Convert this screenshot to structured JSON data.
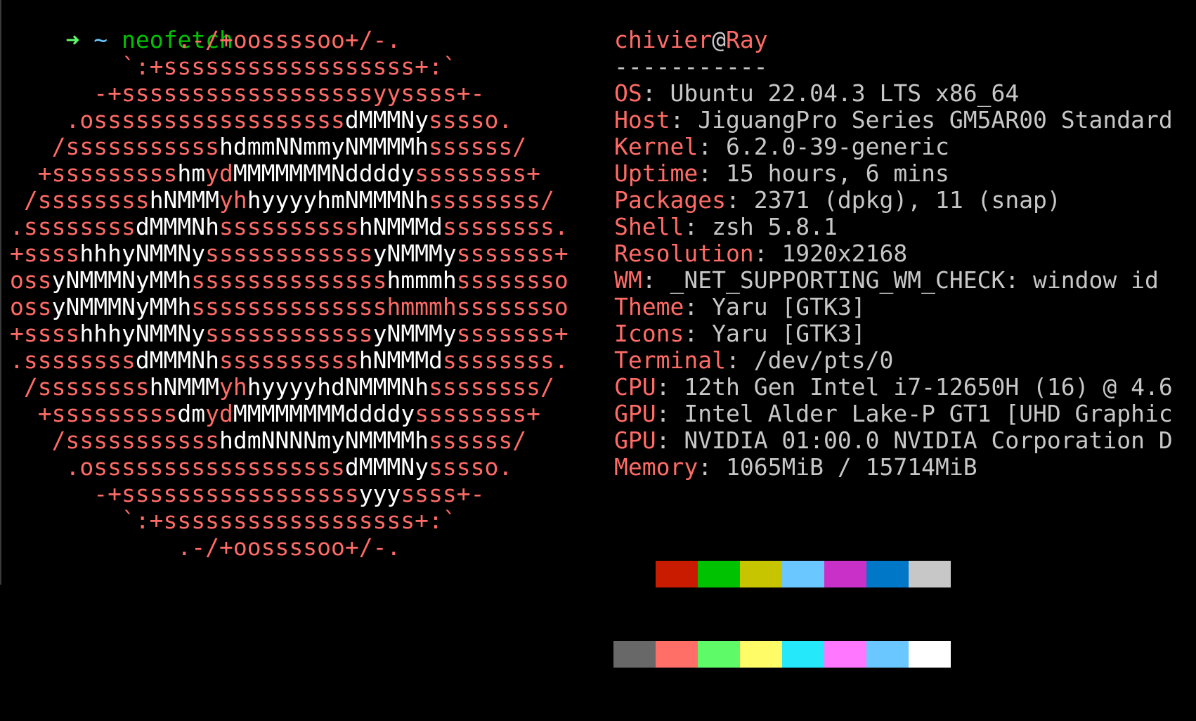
{
  "prompt": {
    "arrow_icon": "right-arrow-icon",
    "arrow_color": "#5ffa68",
    "cwd": "~",
    "cwd_color": "#6ac8ff",
    "command": "neofetch",
    "command_color": "#00c200"
  },
  "colors": {
    "red": "#ff6b66",
    "white": "#ffffff",
    "gray": "#c7c7c7"
  },
  "logo": [
    [
      [
        "            .-/+oossssoo+/-.",
        "red"
      ]
    ],
    [
      [
        "        `:+ssssssssssssssssss+:`",
        "red"
      ]
    ],
    [
      [
        "      -+ssssssssssssssssssyyssss+-",
        "red"
      ]
    ],
    [
      [
        "    .ossssssssssssssssss",
        "red"
      ],
      [
        "dMMMNy",
        "white"
      ],
      [
        "sssso.",
        "red"
      ]
    ],
    [
      [
        "   /sssssssssss",
        "red"
      ],
      [
        "hdmmNNmmyNMMMMh",
        "white"
      ],
      [
        "ssssss/",
        "red"
      ]
    ],
    [
      [
        "  +sssssssss",
        "red"
      ],
      [
        "hm",
        "white"
      ],
      [
        "yd",
        "red"
      ],
      [
        "MMMMMMMNddddy",
        "white"
      ],
      [
        "ssssssss+",
        "red"
      ]
    ],
    [
      [
        " /ssssssss",
        "red"
      ],
      [
        "hNMMM",
        "white"
      ],
      [
        "yh",
        "red"
      ],
      [
        "hyyyyhmNMMMNh",
        "white"
      ],
      [
        "ssssssss/",
        "red"
      ]
    ],
    [
      [
        ".ssssssss",
        "red"
      ],
      [
        "dMMMNh",
        "white"
      ],
      [
        "ssssssssss",
        "red"
      ],
      [
        "hNMMMd",
        "white"
      ],
      [
        "ssssssss.",
        "red"
      ]
    ],
    [
      [
        "+ssss",
        "red"
      ],
      [
        "hhhyNMMNy",
        "white"
      ],
      [
        "ssssssssssss",
        "red"
      ],
      [
        "yNMMMy",
        "white"
      ],
      [
        "sssssss+",
        "red"
      ]
    ],
    [
      [
        "oss",
        "red"
      ],
      [
        "yNMMMNyMMh",
        "white"
      ],
      [
        "ssssssssssssss",
        "red"
      ],
      [
        "hmmmh",
        "white"
      ],
      [
        "ssssssso",
        "red"
      ]
    ],
    [
      [
        "oss",
        "red"
      ],
      [
        "yNMMMNyMMh",
        "white"
      ],
      [
        "sssssssssssssshmmmhssssssso",
        "red"
      ]
    ],
    [
      [
        "+ssss",
        "red"
      ],
      [
        "hhhyNMMNy",
        "white"
      ],
      [
        "ssssssssssss",
        "red"
      ],
      [
        "yNMMMy",
        "white"
      ],
      [
        "sssssss+",
        "red"
      ]
    ],
    [
      [
        ".ssssssss",
        "red"
      ],
      [
        "dMMMNh",
        "white"
      ],
      [
        "ssssssssss",
        "red"
      ],
      [
        "hNMMMd",
        "white"
      ],
      [
        "ssssssss.",
        "red"
      ]
    ],
    [
      [
        " /ssssssss",
        "red"
      ],
      [
        "hNMMM",
        "white"
      ],
      [
        "yh",
        "red"
      ],
      [
        "hyyyyhdNMMMNh",
        "white"
      ],
      [
        "ssssssss/",
        "red"
      ]
    ],
    [
      [
        "  +sssssssss",
        "red"
      ],
      [
        "dm",
        "white"
      ],
      [
        "yd",
        "red"
      ],
      [
        "MMMMMMMMddddy",
        "white"
      ],
      [
        "ssssssss+",
        "red"
      ]
    ],
    [
      [
        "   /sssssssssss",
        "red"
      ],
      [
        "hdmNNNNmyNMMMMh",
        "white"
      ],
      [
        "ssssss/",
        "red"
      ]
    ],
    [
      [
        "    .ossssssssssssssssss",
        "red"
      ],
      [
        "dMMMNy",
        "white"
      ],
      [
        "sssso.",
        "red"
      ]
    ],
    [
      [
        "      -+sssssssssssssssss",
        "red"
      ],
      [
        "yyy",
        "white"
      ],
      [
        "ssss+-",
        "red"
      ]
    ],
    [
      [
        "        `:+ssssssssssssssssss+:`",
        "red"
      ]
    ],
    [
      [
        "            .-/+oossssoo+/-.",
        "red"
      ]
    ]
  ],
  "info": {
    "user": "chivier",
    "at": "@",
    "host": "Ray",
    "underline": "-----------",
    "fields": [
      {
        "key": "OS",
        "value": "Ubuntu 22.04.3 LTS x86_64"
      },
      {
        "key": "Host",
        "value": "JiguangPro Series GM5AR00 Standard"
      },
      {
        "key": "Kernel",
        "value": "6.2.0-39-generic"
      },
      {
        "key": "Uptime",
        "value": "15 hours, 6 mins"
      },
      {
        "key": "Packages",
        "value": "2371 (dpkg), 11 (snap)"
      },
      {
        "key": "Shell",
        "value": "zsh 5.8.1"
      },
      {
        "key": "Resolution",
        "value": "1920x2168"
      },
      {
        "key": "WM",
        "value": "_NET_SUPPORTING_WM_CHECK: window id"
      },
      {
        "key": "Theme",
        "value": "Yaru [GTK3]"
      },
      {
        "key": "Icons",
        "value": "Yaru [GTK3]"
      },
      {
        "key": "Terminal",
        "value": "/dev/pts/0"
      },
      {
        "key": "CPU",
        "value": "12th Gen Intel i7-12650H (16) @ 4.6"
      },
      {
        "key": "GPU",
        "value": "Intel Alder Lake-P GT1 [UHD Graphic"
      },
      {
        "key": "GPU",
        "value": "NVIDIA 01:00.0 NVIDIA Corporation D"
      },
      {
        "key": "Memory",
        "value": "1065MiB / 15714MiB"
      }
    ],
    "separator": ": "
  },
  "palette": {
    "normal": [
      "#000000",
      "#c91b00",
      "#00c200",
      "#c7c400",
      "#6ac7ff",
      "#c930c7",
      "#0077c7",
      "#c7c7c7"
    ],
    "bright": [
      "#686868",
      "#ff6e67",
      "#5ffa68",
      "#fffc67",
      "#25e8fb",
      "#ff77ff",
      "#6ac7ff",
      "#ffffff"
    ]
  }
}
